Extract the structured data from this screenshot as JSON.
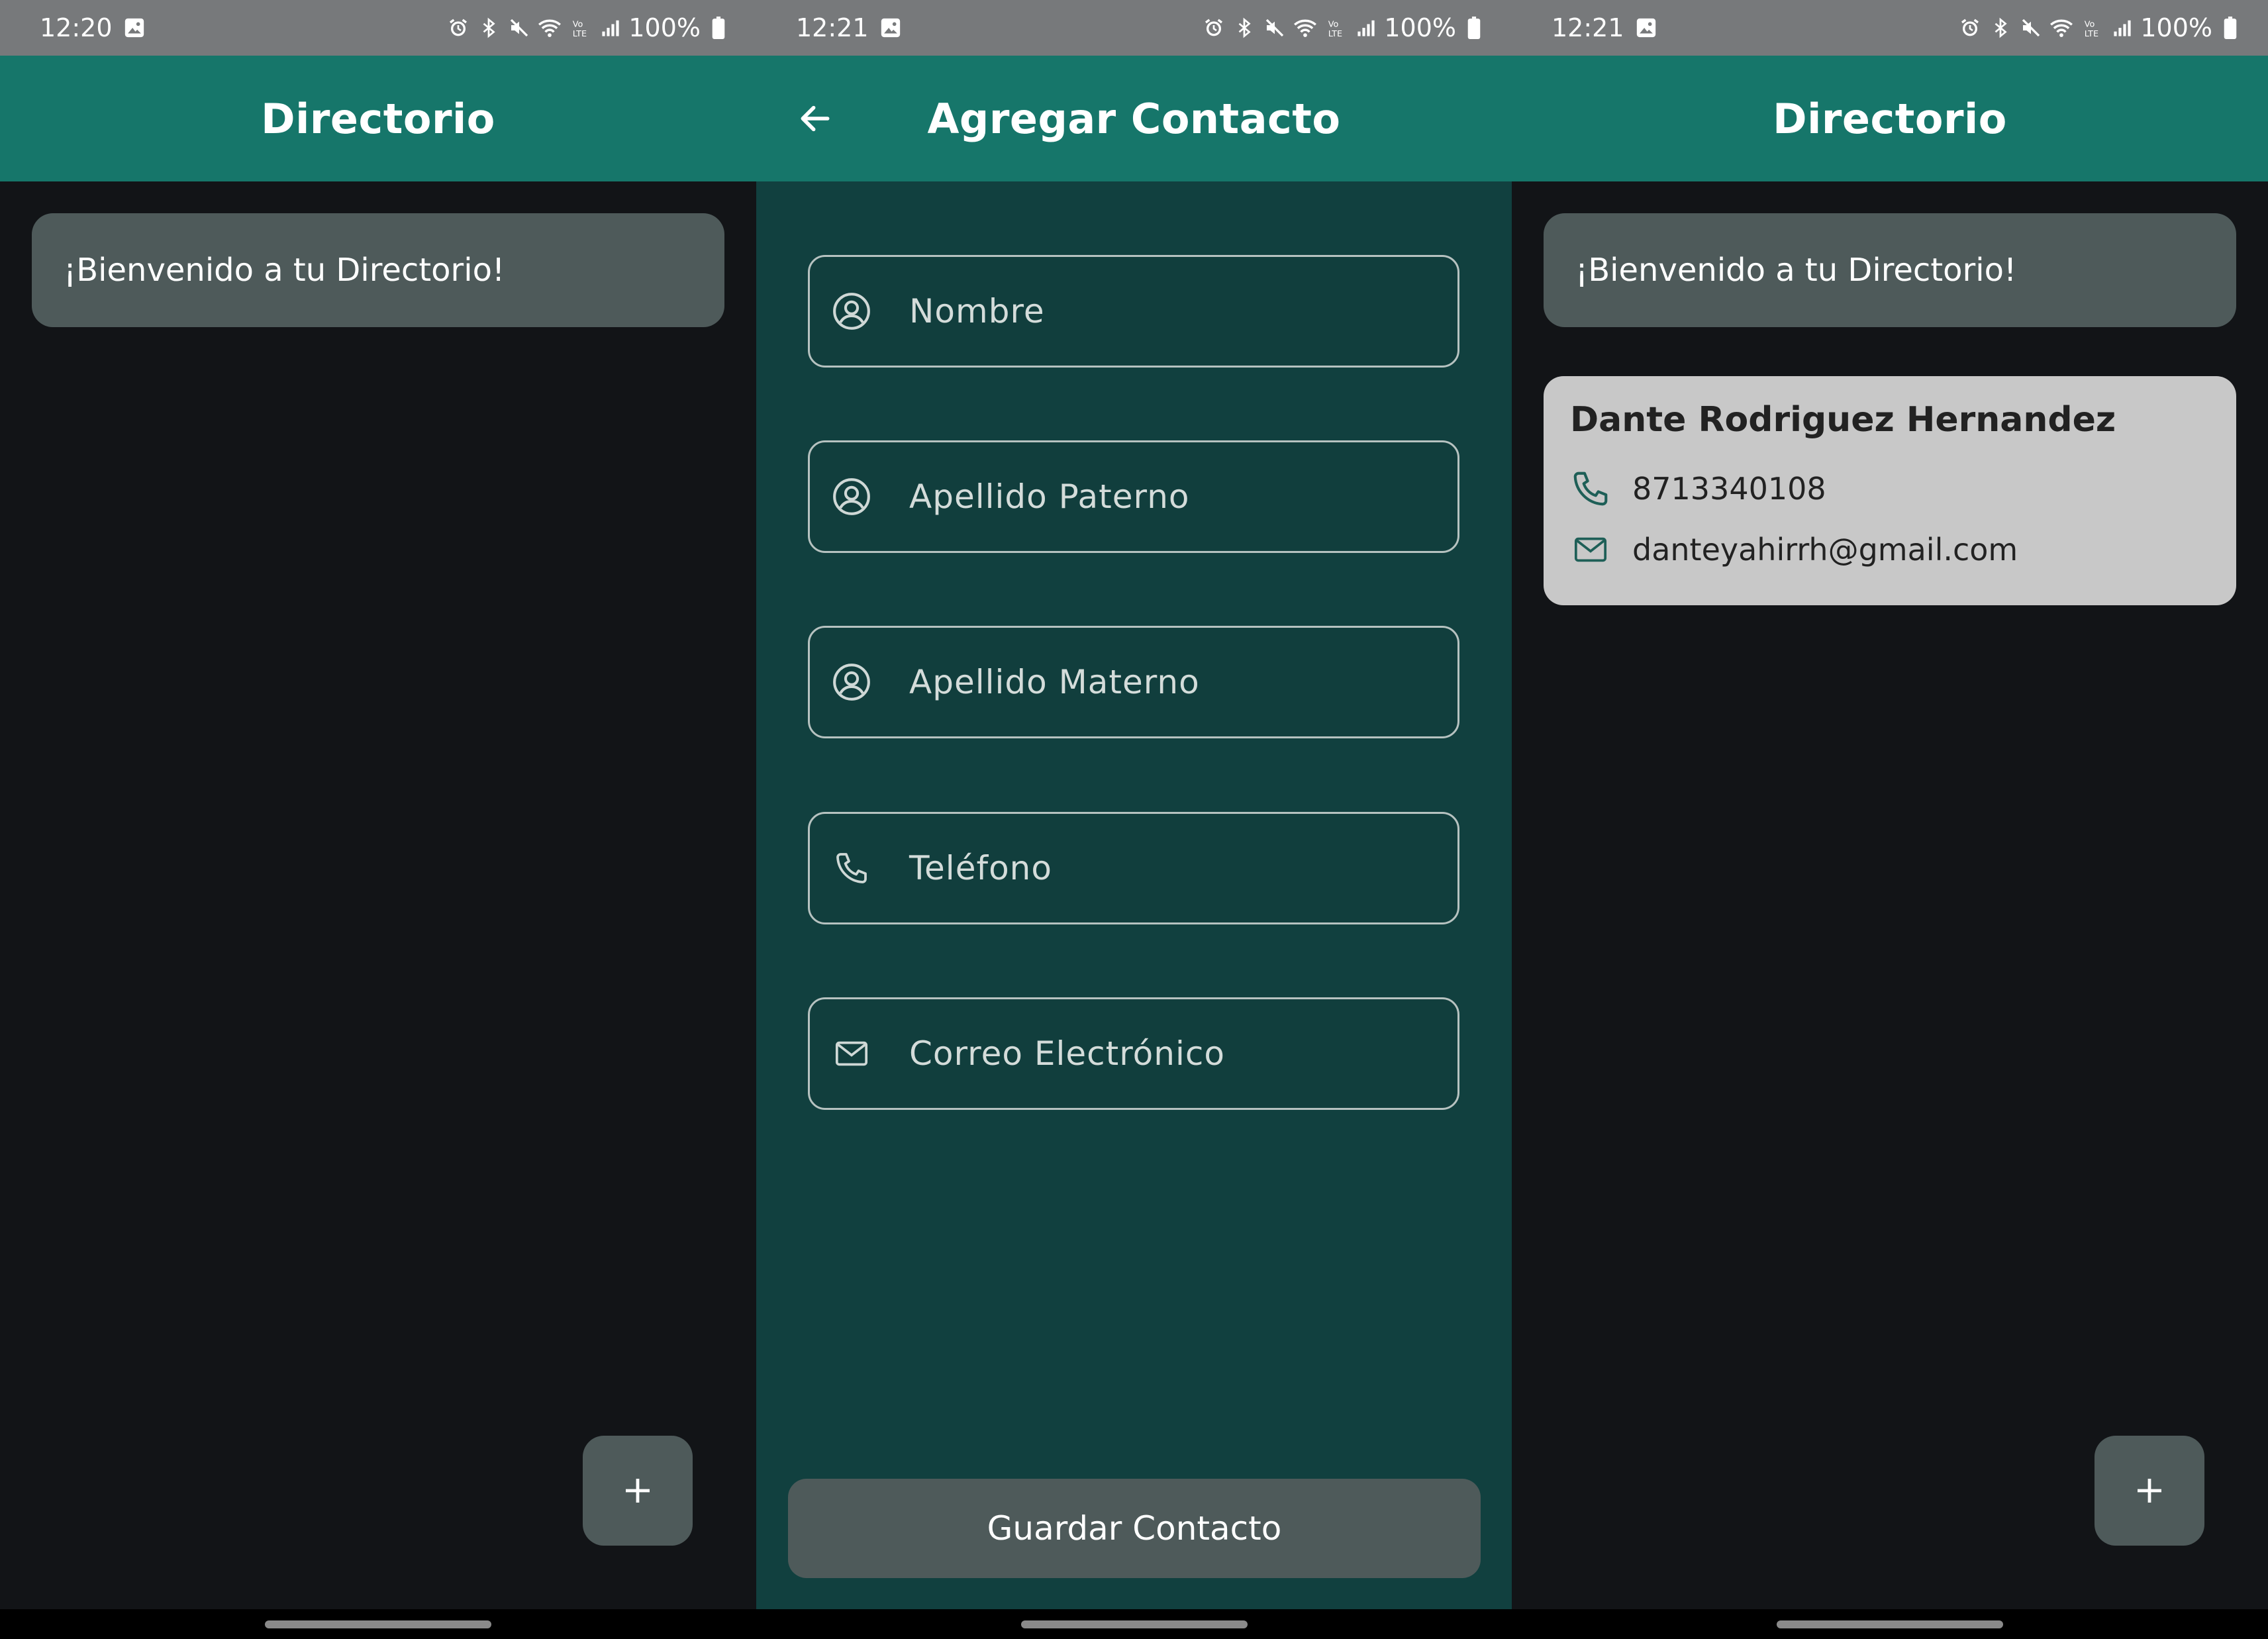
{
  "screens": [
    {
      "status": {
        "time": "12:20",
        "battery": "100%"
      },
      "appbar": {
        "title": "Directorio"
      },
      "welcome": "¡Bienvenido a tu Directorio!",
      "fab_label": "+"
    },
    {
      "status": {
        "time": "12:21",
        "battery": "100%"
      },
      "appbar": {
        "title": "Agregar Contacto",
        "back_icon": "arrow-left-icon"
      },
      "form": {
        "fields": [
          {
            "placeholder": "Nombre",
            "icon": "person-icon"
          },
          {
            "placeholder": "Apellido Paterno",
            "icon": "person-icon"
          },
          {
            "placeholder": "Apellido Materno",
            "icon": "person-icon"
          },
          {
            "placeholder": "Teléfono",
            "icon": "phone-icon"
          },
          {
            "placeholder": "Correo Electrónico",
            "icon": "mail-icon"
          }
        ],
        "save_label": "Guardar Contacto"
      }
    },
    {
      "status": {
        "time": "12:21",
        "battery": "100%"
      },
      "appbar": {
        "title": "Directorio"
      },
      "welcome": "¡Bienvenido a tu Directorio!",
      "contact": {
        "name": "Dante Rodriguez Hernandez",
        "phone": "8713340108",
        "email": "danteyahirrh@gmail.com"
      },
      "fab_label": "+"
    }
  ],
  "colors": {
    "appbar": "#16766a",
    "form_bg": "#11403f",
    "list_bg": "#121417",
    "surface": "#4e5a5a",
    "card": "#c8c8c8"
  }
}
